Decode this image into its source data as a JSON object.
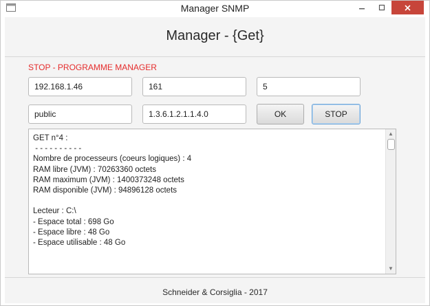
{
  "window": {
    "title": "Manager SNMP",
    "minimize_icon": "minimize-icon",
    "maximize_icon": "maximize-icon",
    "close_icon": "close-icon"
  },
  "header": {
    "title": "Manager - {Get}"
  },
  "status": {
    "text": "STOP - PROGRAMME MANAGER",
    "color": "#e52b2b"
  },
  "form": {
    "ip_address": "192.168.1.46",
    "port": "161",
    "interval": "5",
    "community": "public",
    "oid": "1.3.6.1.2.1.1.4.0",
    "ok_label": "OK",
    "stop_label": "STOP"
  },
  "output": {
    "lines": [
      "GET n°4 :",
      " - - - - - - - - - -",
      "Nombre de processeurs (coeurs logiques) : 4",
      "RAM libre (JVM) : 70263360 octets",
      "RAM maximum (JVM) : 1400373248 octets",
      "RAM disponible (JVM) : 94896128 octets",
      "",
      "Lecteur : C:\\",
      "- Espace total : 698 Go",
      "- Espace libre : 48 Go",
      "- Espace utilisable : 48 Go"
    ]
  },
  "footer": {
    "text": "Schneider & Corsiglia - 2017"
  }
}
